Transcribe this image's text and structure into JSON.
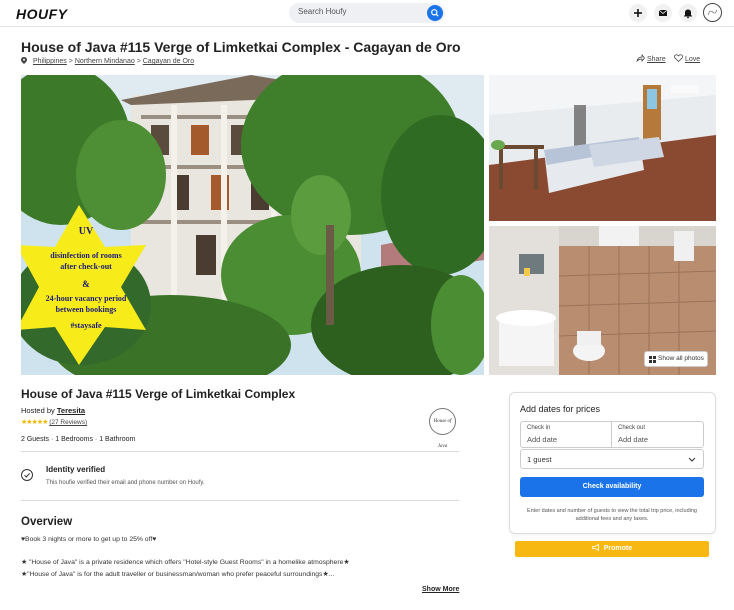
{
  "header": {
    "logo": "HOUFY",
    "search_placeholder": "Search Houfy"
  },
  "listing": {
    "title": "House of Java #115 Verge of Limketkai Complex - Cagayan de Oro",
    "breadcrumbs": [
      "Philippines",
      "Northern Mindanao",
      "Cagayan de Oro"
    ],
    "breadcrumb_sep": ">",
    "share_label": "Share",
    "love_label": "Love",
    "photo_badge": {
      "line1": "UV",
      "line2": "disinfection of rooms",
      "line3": "after check-out",
      "line4": "&",
      "line5": "24-hour vacancy period",
      "line6": "between bookings",
      "line7": "#staysafe"
    },
    "show_all_photos": "Show all photos"
  },
  "details": {
    "heading": "House of Java #115 Verge of Limketkai Complex",
    "hosted_by_prefix": "Hosted by",
    "host_name": "Teresita",
    "stars": "★★★★★",
    "reviews": "(27 Reviews)",
    "facts": "2 Guests · 1 Bedrooms · 1 Bathroom",
    "verified_title": "Identity verified",
    "verified_text": "This houfie verified their email and phone number on Houfy.",
    "overview_title": "Overview",
    "desc_line1": "♥Book 3 nights or more to get up to 25% off♥",
    "desc_line2": "★ \"House of Java\" is a private residence which offers \"Hotel-style Guest Rooms\" in a homelike atmosphere★",
    "desc_line3": "★\"House of Java\" is for the adult traveller or businessman/woman who prefer peaceful surroundings★...",
    "show_more": "Show More"
  },
  "booking": {
    "title": "Add dates for prices",
    "check_in_label": "Check in",
    "check_in_placeholder": "Add date",
    "check_out_label": "Check out",
    "check_out_placeholder": "Add date",
    "guests_value": "1 guest",
    "check_button": "Check availability",
    "note": "Enter dates and number of guests to view the total trip price, including additional fees and any taxes.",
    "promote_button": "Promote"
  },
  "colors": {
    "accent_blue": "#1a73e8",
    "promote_yellow": "#f8b812",
    "star_yellow": "#f5b800"
  }
}
